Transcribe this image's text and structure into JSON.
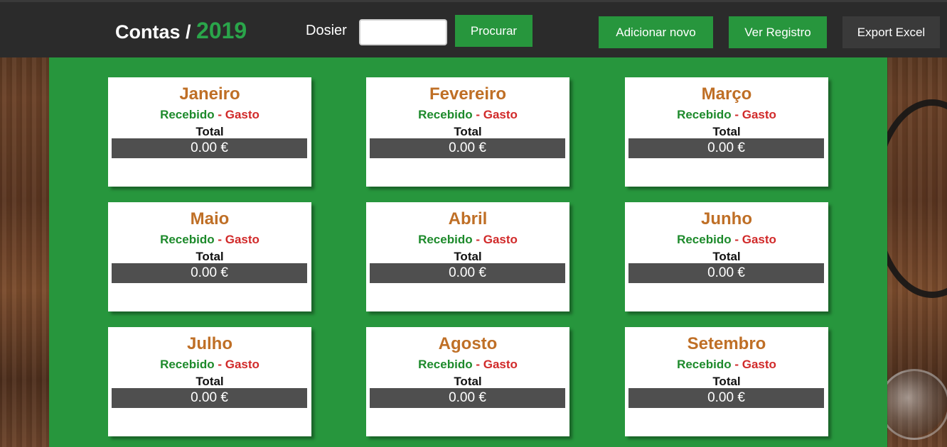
{
  "header": {
    "title": "Contas /",
    "year": "2019",
    "dosier_label": "Dosier",
    "dosier_value": "",
    "search_button": "Procurar",
    "add_button": "Adicionar novo",
    "registry_button": "Ver Registro",
    "export_button": "Export Excel"
  },
  "card_labels": {
    "received": "Recebido",
    "separator": " - ",
    "spent": "Gasto",
    "total": "Total"
  },
  "months": [
    {
      "name": "Janeiro",
      "amount": "0.00 €"
    },
    {
      "name": "Fevereiro",
      "amount": "0.00 €"
    },
    {
      "name": "Março",
      "amount": "0.00 €"
    },
    {
      "name": "Maio",
      "amount": "0.00 €"
    },
    {
      "name": "Abril",
      "amount": "0.00 €"
    },
    {
      "name": "Junho",
      "amount": "0.00 €"
    },
    {
      "name": "Julho",
      "amount": "0.00 €"
    },
    {
      "name": "Agosto",
      "amount": "0.00 €"
    },
    {
      "name": "Setembro",
      "amount": "0.00 €"
    }
  ],
  "colors": {
    "accent_green": "#27963d",
    "month_title": "#bf6f26",
    "received": "#1d8a2b",
    "spent": "#d12a2a",
    "topbar": "#2b2b2b",
    "amount_bar": "#4f4f4f"
  }
}
